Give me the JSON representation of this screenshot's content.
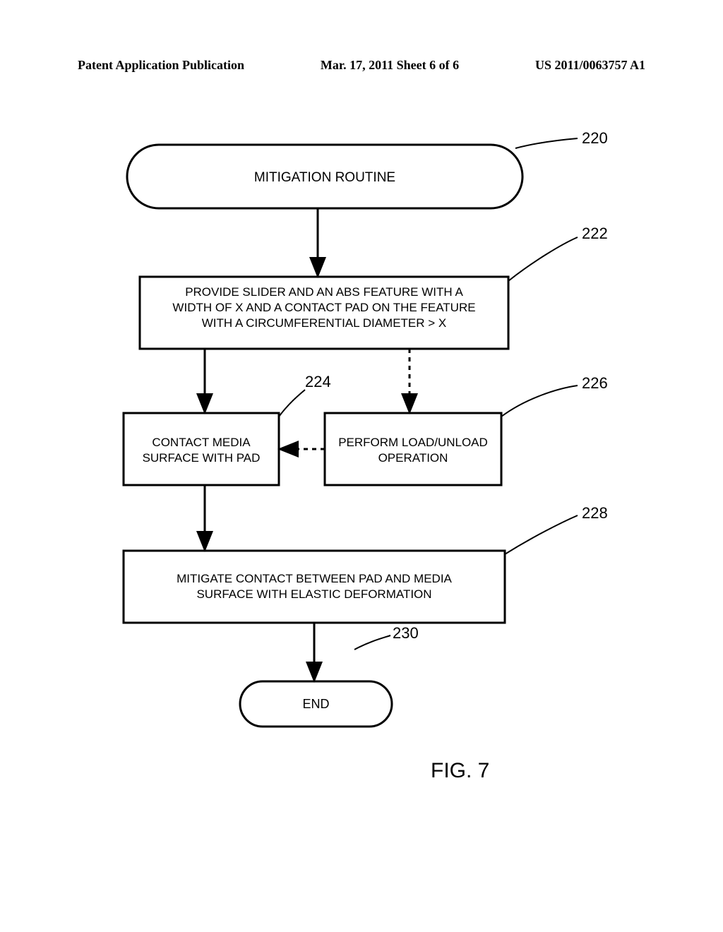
{
  "header": {
    "left": "Patent Application Publication",
    "center": "Mar. 17, 2011  Sheet 6 of 6",
    "right": "US 2011/0063757 A1"
  },
  "flow": {
    "start": "MITIGATION ROUTINE",
    "step1": "PROVIDE SLIDER AND AN ABS FEATURE WITH A\nWIDTH OF X AND A CONTACT PAD ON THE FEATURE\nWITH A CIRCUMFERENTIAL DIAMETER > X",
    "step2_left": "CONTACT MEDIA\nSURFACE WITH PAD",
    "step2_right": "PERFORM LOAD/UNLOAD\nOPERATION",
    "step3": "MITIGATE CONTACT BETWEEN PAD AND MEDIA\nSURFACE WITH ELASTIC DEFORMATION",
    "end": "END"
  },
  "refs": {
    "r220": "220",
    "r222": "222",
    "r224": "224",
    "r226": "226",
    "r228": "228",
    "r230": "230"
  },
  "figure_label": "FIG. 7"
}
